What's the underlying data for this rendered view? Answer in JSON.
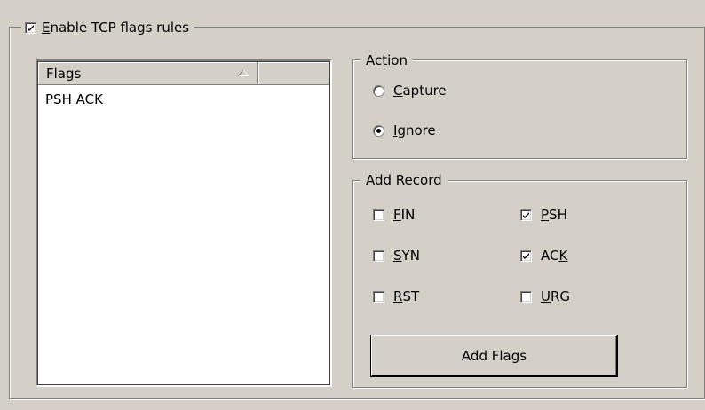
{
  "enable_rules": {
    "label_prefix": "",
    "label_accel": "E",
    "label_rest": "nable TCP flags rules",
    "checked": true
  },
  "flags_list": {
    "columns": [
      "Flags",
      ""
    ],
    "sort_icon": "sort-ascending-triangle-icon",
    "rows": [
      "PSH ACK"
    ]
  },
  "action": {
    "title": "Action",
    "capture": {
      "accel": "C",
      "rest": "apture",
      "selected": false
    },
    "ignore": {
      "accel": "I",
      "rest": "gnore",
      "selected": true
    }
  },
  "add_record": {
    "title": "Add Record",
    "fin": {
      "accel": "F",
      "rest": "IN",
      "checked": false
    },
    "syn": {
      "accel": "S",
      "rest": "YN",
      "checked": false
    },
    "rst": {
      "accel": "R",
      "rest": "ST",
      "checked": false
    },
    "psh": {
      "accel": "P",
      "rest": "SH",
      "checked": true
    },
    "ack": {
      "pre": "AC",
      "accel": "K",
      "checked": true
    },
    "urg": {
      "accel": "U",
      "rest": "RG",
      "checked": false
    },
    "add_button_label": "Add Flags"
  }
}
